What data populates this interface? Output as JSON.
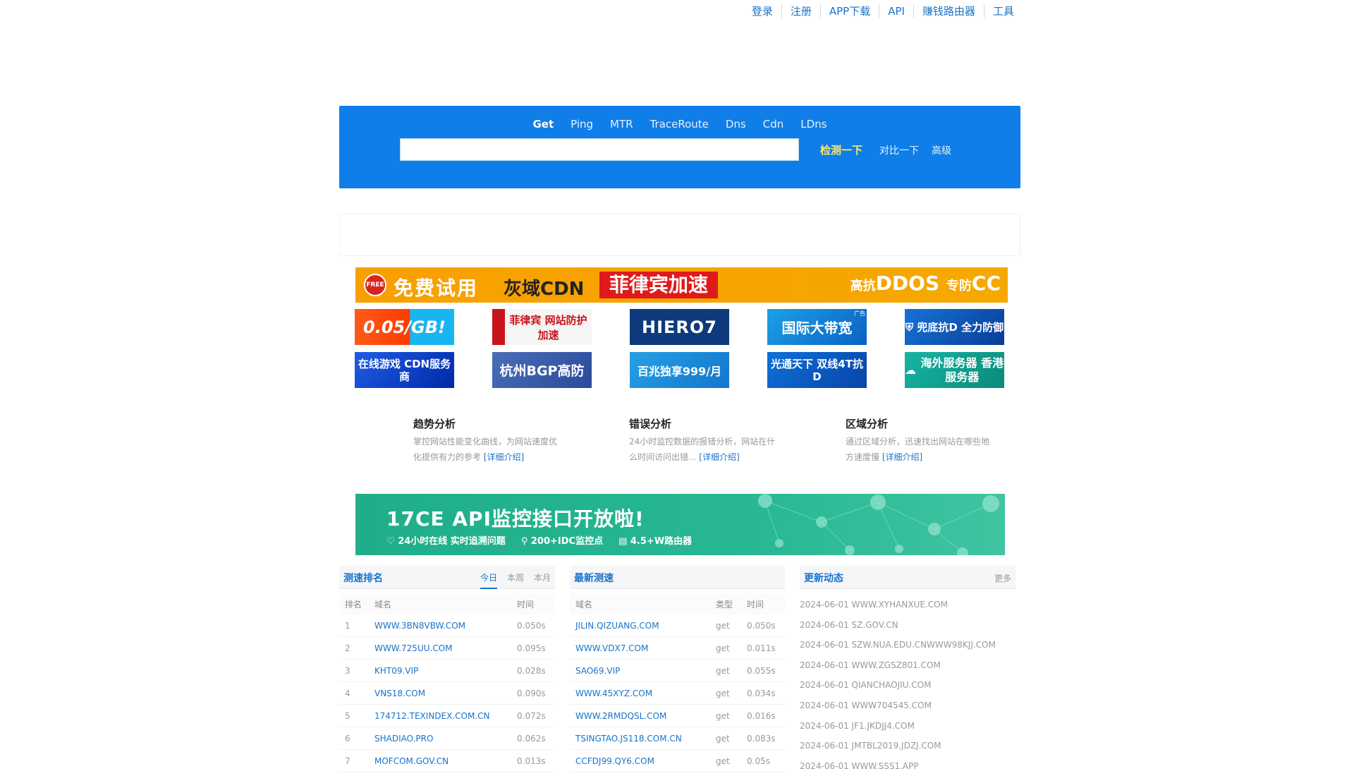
{
  "top_links": [
    "登录",
    "注册",
    "APP下载",
    "API",
    "赚钱路由器",
    "工具"
  ],
  "search": {
    "tabs": [
      "Get",
      "Ping",
      "MTR",
      "TraceRoute",
      "Dns",
      "Cdn",
      "LDns"
    ],
    "active_tab": "Get",
    "input_value": "",
    "check_label": "检测一下",
    "compare_label": "对比一下",
    "advanced_label": "高级"
  },
  "wide_banner": {
    "free": "FREE",
    "text1": "免费试用",
    "text2": "灰域CDN",
    "text3": "菲律宾加速",
    "text4_small1": "高抗",
    "text4_big1": "DDOS",
    "text4_small2": "专防",
    "text4_big2": "CC"
  },
  "ads": [
    {
      "text": "0.05/GB!"
    },
    {
      "text": "菲律宾 网站防护加速"
    },
    {
      "text": "HIERO7"
    },
    {
      "text": "国际大带宽",
      "tag": "广告"
    },
    {
      "text": "兜底抗D 全力防御"
    },
    {
      "text": "在线游戏 CDN服务商"
    },
    {
      "text": "杭州BGP高防"
    },
    {
      "text": "百兆独享999/月"
    },
    {
      "text": "光通天下 双线4T抗D"
    },
    {
      "text": "海外服务器 香港服务器"
    }
  ],
  "features": [
    {
      "title": "趋势分析",
      "desc": "掌控网站性能变化曲线，为网站速度优化提供有力的参考",
      "more": "[详细介绍]"
    },
    {
      "title": "错误分析",
      "desc": "24小时监控数据的报错分析，网站在什么时间访问出错...",
      "more": "[详细介绍]"
    },
    {
      "title": "区域分析",
      "desc": "通过区域分析，迅速找出网站在哪些地方速度慢",
      "more": "[详细介绍]"
    }
  ],
  "api_banner": {
    "title": "17CE  API监控接口开放啦!",
    "items": [
      "24小时在线   实时追溯问题",
      "200+IDC监控点",
      "4.5+W路由器"
    ]
  },
  "rank_panel": {
    "title": "测速排名",
    "tabs": [
      "今日",
      "本周",
      "本月"
    ],
    "columns": [
      "排名",
      "域名",
      "时间"
    ],
    "rows": [
      [
        "1",
        "WWW.3BN8VBW.COM",
        "0.050s"
      ],
      [
        "2",
        "WWW.725UU.COM",
        "0.095s"
      ],
      [
        "3",
        "KHT09.VIP",
        "0.028s"
      ],
      [
        "4",
        "VNS18.COM",
        "0.090s"
      ],
      [
        "5",
        "174712.TEXINDEX.COM.CN",
        "0.072s"
      ],
      [
        "6",
        "SHADIAO.PRO",
        "0.062s"
      ],
      [
        "7",
        "MOFCOM.GOV.CN",
        "0.013s"
      ]
    ]
  },
  "latest_panel": {
    "title": "最新测速",
    "columns": [
      "域名",
      "类型",
      "时间"
    ],
    "rows": [
      [
        "JILIN.QIZUANG.COM",
        "get",
        "0.050s"
      ],
      [
        "WWW.VDX7.COM",
        "get",
        "0.011s"
      ],
      [
        "SAO69.VIP",
        "get",
        "0.055s"
      ],
      [
        "WWW.45XYZ.COM",
        "get",
        "0.034s"
      ],
      [
        "WWW.2RMDQSL.COM",
        "get",
        "0.016s"
      ],
      [
        "TSINGTAO.JS118.COM.CN",
        "get",
        "0.083s"
      ],
      [
        "CCFDJ99.QY6.COM",
        "get",
        "0.05s"
      ]
    ]
  },
  "news_panel": {
    "title": "更新动态",
    "more": "更多",
    "items": [
      "2024-06-01 WWW.XYHANXUE.COM",
      "2024-06-01 SZ.GOV.CN",
      "2024-06-01 SZW.NUA.EDU.CNWWW98KJJ.COM",
      "2024-06-01 WWW.ZGSZ801.COM",
      "2024-06-01 QIANCHAOJIU.COM",
      "2024-06-01 WWW704545.COM",
      "2024-06-01 JF1.JKDJJ4.COM",
      "2024-06-01 JMTBL2019.JDZJ.COM",
      "2024-06-01 WWW.SSS1.APP"
    ]
  }
}
